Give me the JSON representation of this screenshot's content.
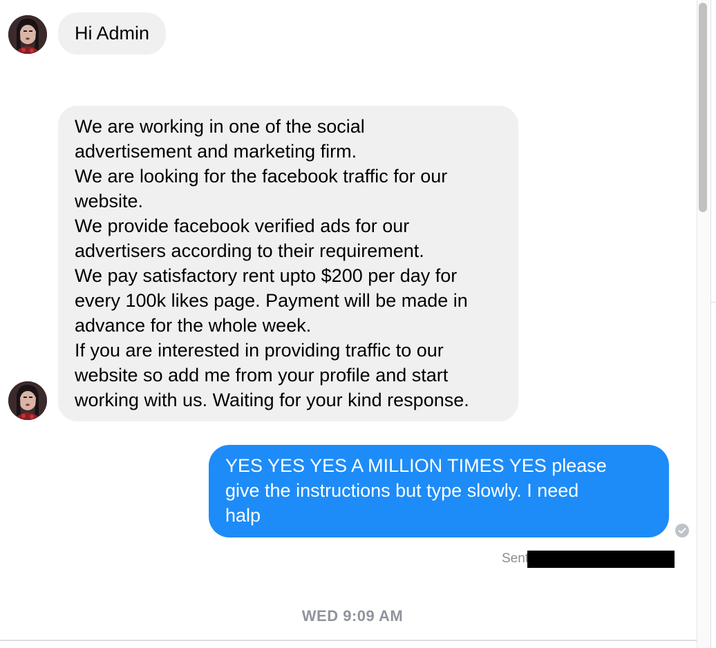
{
  "messages": {
    "greeting": "Hi Admin",
    "pitch_lines": [
      "We are working in one of the social",
      "advertisement and marketing firm.",
      "We are looking for the facebook traffic for our",
      "website.",
      "We provide facebook verified ads for our",
      "advertisers according to their requirement.",
      "We pay satisfactory rent upto $200 per day for",
      "every 100k likes page. Payment will be made in",
      "advance for the whole week.",
      "If you are interested in providing traffic to our",
      "website so add me from your profile and start",
      "working with us. Waiting for your kind response."
    ],
    "reply_lines": [
      "YES YES YES A MILLION TIMES YES please",
      "give the instructions but type slowly. I need",
      "halp"
    ],
    "sent_label": "Sent",
    "timestamp_divider": "WED 9:09 AM"
  },
  "colors": {
    "incoming_bubble": "#f0f0f0",
    "outgoing_bubble": "#1d8cf8",
    "meta_text": "#90949c"
  },
  "icons": {
    "seen_indicator": "check-circle-icon",
    "avatar": "contact-avatar"
  }
}
